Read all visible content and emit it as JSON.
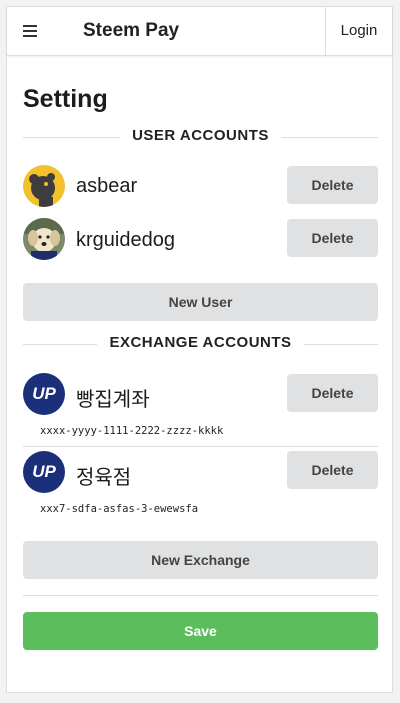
{
  "header": {
    "menu_icon": "hamburger-icon",
    "title": "Steem Pay",
    "login_label": "Login"
  },
  "page": {
    "title": "Setting"
  },
  "user_section": {
    "heading": "USER ACCOUNTS",
    "users": [
      {
        "name": "asbear",
        "avatar": "bear-avatar",
        "delete_label": "Delete"
      },
      {
        "name": "krguidedog",
        "avatar": "dog-avatar",
        "delete_label": "Delete"
      }
    ],
    "new_user_label": "New User"
  },
  "exchange_section": {
    "heading": "EXCHANGE ACCOUNTS",
    "accounts": [
      {
        "logo_text": "UP",
        "name": "빵집계좌",
        "id": "xxxx-yyyy-1111-2222-zzzz-kkkk",
        "delete_label": "Delete"
      },
      {
        "logo_text": "UP",
        "name": "정육점",
        "id": "xxx7-sdfa-asfas-3-ewewsfa",
        "delete_label": "Delete"
      }
    ],
    "new_exchange_label": "New Exchange"
  },
  "save_label": "Save",
  "colors": {
    "save": "#5bbd5b",
    "button_gray": "#e0e1e2",
    "exchange_logo": "#1b2f7a"
  }
}
